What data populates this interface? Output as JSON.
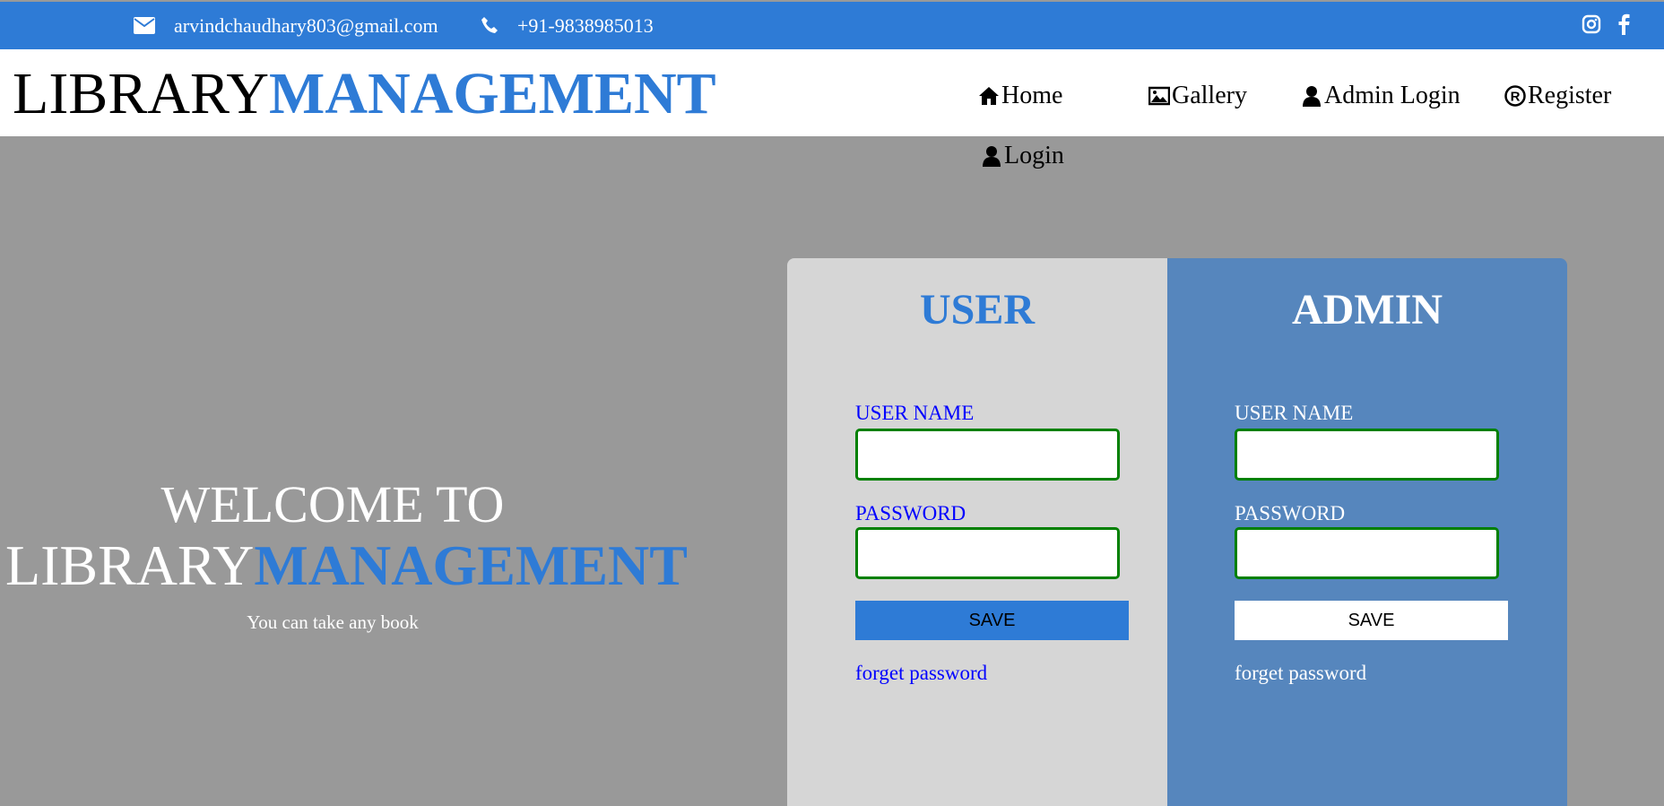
{
  "topbar": {
    "email": "arvindchaudhary803@gmail.com",
    "phone": "+91-9838985013"
  },
  "logo": {
    "part1": "LIBRARY",
    "part2": "MANAGEMENT"
  },
  "nav": [
    {
      "label": "Home",
      "icon": "home-icon"
    },
    {
      "label": "Gallery",
      "icon": "image-icon"
    },
    {
      "label": "Admin Login",
      "icon": "user-icon"
    },
    {
      "label": "Register",
      "icon": "registered-icon"
    },
    {
      "label": "Login",
      "icon": "user-icon"
    }
  ],
  "hero": {
    "line1": "WELCOME TO",
    "part1": "LIBRARY",
    "part2": "MANAGEMENT",
    "tagline": "You can take any book"
  },
  "user_panel": {
    "title": "USER",
    "username_label": "USER NAME",
    "password_label": "PASSWORD",
    "save": "SAVE",
    "forgot": "forget password"
  },
  "admin_panel": {
    "title": "ADMIN",
    "username_label": "USER NAME",
    "password_label": "PASSWORD",
    "save": "SAVE",
    "forgot": "forget password"
  },
  "colors": {
    "brand": "#2e7bd6",
    "admin_bg": "#5686bd",
    "user_bg": "#d6d6d6",
    "input_border": "#008000"
  }
}
